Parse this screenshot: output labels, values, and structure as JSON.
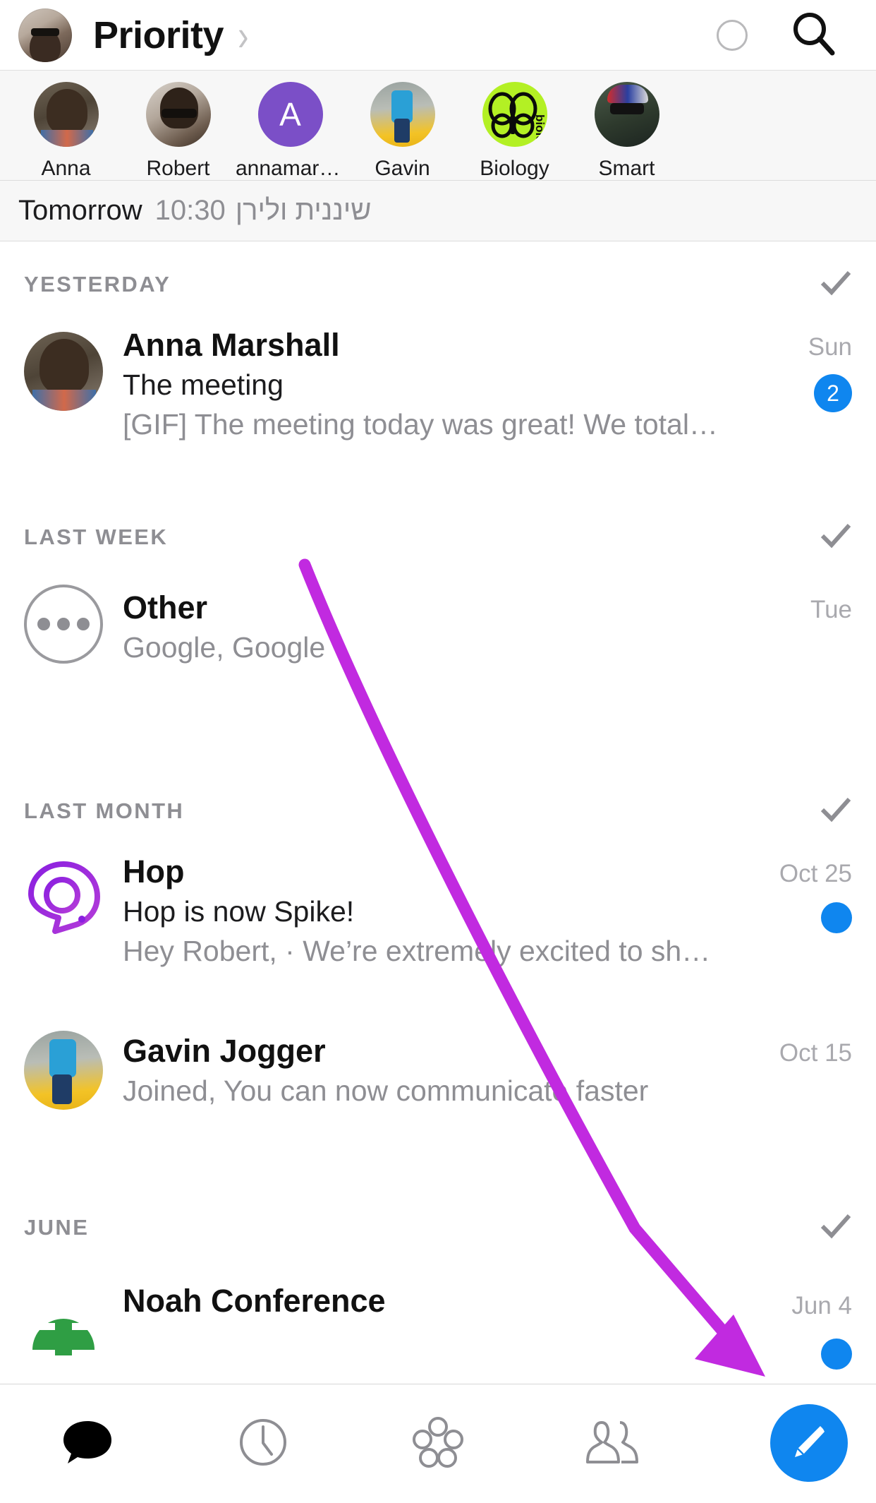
{
  "header": {
    "title": "Priority",
    "chevron": "›",
    "avatar_name": "user-avatar",
    "status_circle_name": "status-circle-icon",
    "search_name": "search-icon"
  },
  "avatar_strip": {
    "items": [
      {
        "label": "Anna",
        "kind": "photo",
        "art": "av-anna"
      },
      {
        "label": "Robert",
        "kind": "photo",
        "art": "av-robert"
      },
      {
        "label": "annamarsh…",
        "kind": "initial",
        "art": "av-initial",
        "initial": "A",
        "color": "#7b4fc7"
      },
      {
        "label": "Gavin",
        "kind": "photo",
        "art": "av-gavin"
      },
      {
        "label": "Biology",
        "kind": "logo",
        "art": "av-bio",
        "color": "#b3f024"
      },
      {
        "label": "Smart",
        "kind": "photo",
        "art": "av-smart"
      }
    ]
  },
  "tomorrow_bar": {
    "label": "Tomorrow",
    "time": "10:30",
    "participants": "שיננית ולירן"
  },
  "sections": [
    {
      "title": "YESTERDAY",
      "check_icon": "check-icon",
      "rows": [
        {
          "name": "Anna Marshall",
          "subject": "The meeting",
          "snippet": "[GIF] The meeting today was great! We total…",
          "date": "Sun",
          "badge": "2",
          "badge_type": "count",
          "avatar": "ra-anna"
        }
      ]
    },
    {
      "title": "LAST WEEK",
      "check_icon": "check-icon",
      "rows": [
        {
          "name": "Other",
          "subject": "",
          "snippet": "Google, Google",
          "date": "Tue",
          "badge": "",
          "badge_type": "none",
          "avatar": "ra-other"
        }
      ]
    },
    {
      "title": "LAST MONTH",
      "check_icon": "check-icon",
      "rows": [
        {
          "name": "Hop",
          "subject": "Hop is now Spike!",
          "snippet": "Hey Robert, · We’re extremely excited to share…",
          "date": "Oct 25",
          "badge": "",
          "badge_type": "dot",
          "avatar": "ra-hop"
        },
        {
          "name": "Gavin Jogger",
          "subject": "",
          "snippet": "Joined, You can now communicate faster",
          "date": "Oct 15",
          "badge": "",
          "badge_type": "none",
          "avatar": "ra-gavin"
        }
      ]
    },
    {
      "title": "JUNE",
      "check_icon": "check-icon",
      "rows": [
        {
          "name": "Noah Conference",
          "subject": "",
          "snippet": "",
          "date": "Jun 4",
          "badge": "",
          "badge_type": "dot",
          "avatar": "ra-noah"
        }
      ]
    }
  ],
  "tabbar": {
    "items": [
      {
        "icon": "chat-bubble-icon",
        "active": true
      },
      {
        "icon": "clock-icon",
        "active": false
      },
      {
        "icon": "groups-icon",
        "active": false
      },
      {
        "icon": "people-icon",
        "active": false
      }
    ],
    "compose": {
      "icon": "pencil-icon",
      "color": "#0f86ef"
    }
  },
  "annotation": {
    "arrow_color": "#c12ae0",
    "arrow_from": "below Anna Marshall row",
    "arrow_to": "Jun 4 date on Noah Conference row"
  }
}
